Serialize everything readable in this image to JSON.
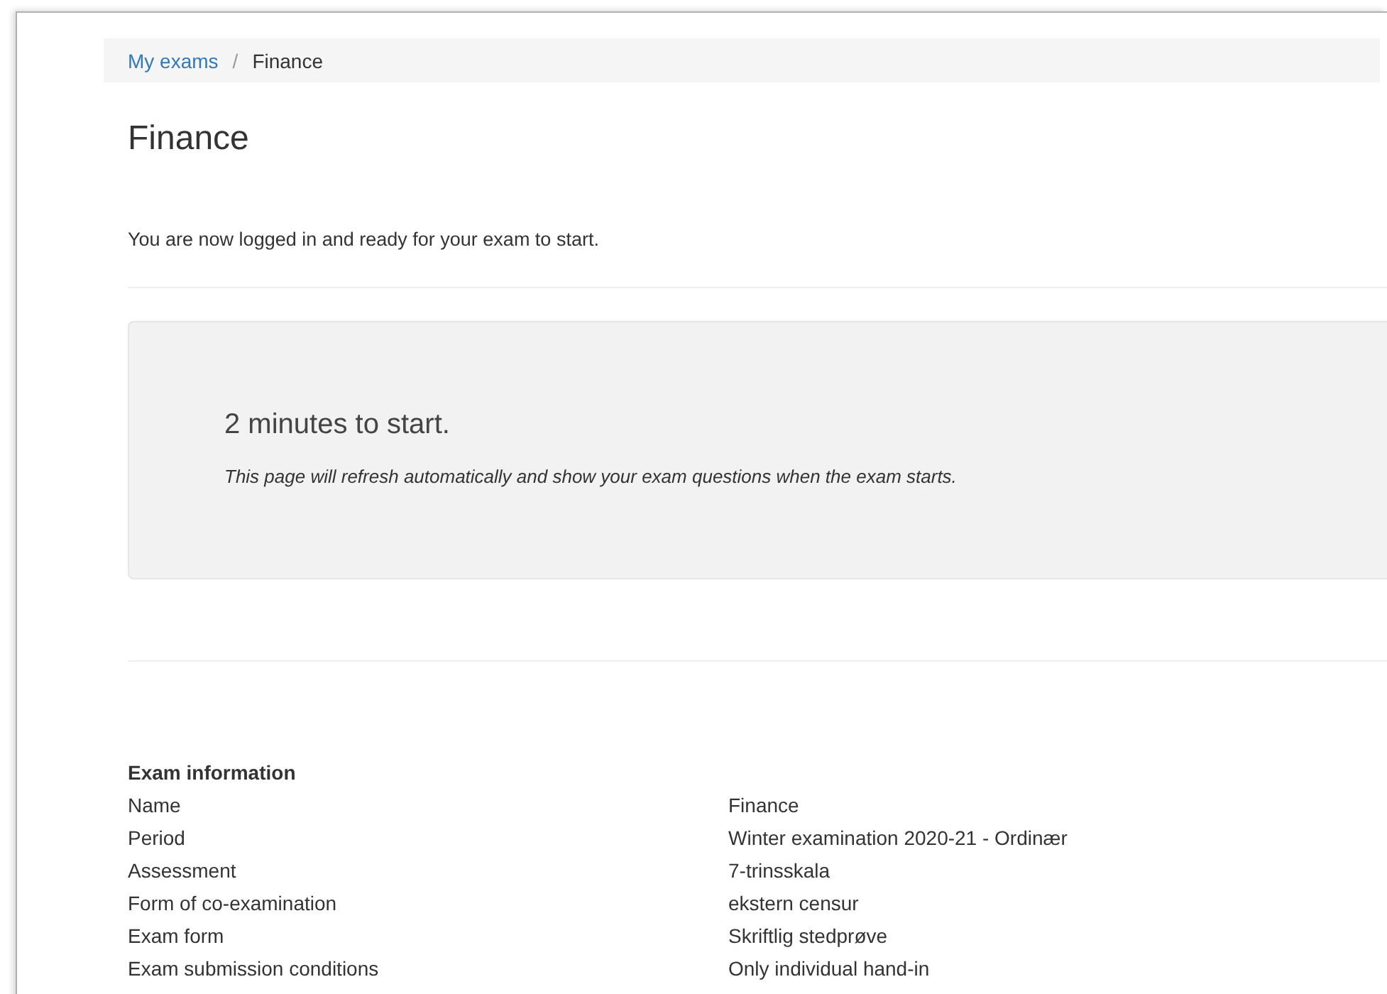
{
  "breadcrumb": [
    {
      "label": "My exams",
      "kind": "link"
    },
    {
      "label": "Finance",
      "kind": "current"
    }
  ],
  "breadcrumb_separator": "/",
  "title": "Finance",
  "intro": "You are now logged in and ready for your exam to start.",
  "countdown": {
    "heading": "2 minutes to start.",
    "note": "This page will refresh automatically and show your exam questions when the exam starts."
  },
  "exam_information": {
    "heading": "Exam information",
    "rows": [
      {
        "label": "Name",
        "value": "Finance"
      },
      {
        "label": "Period",
        "value": "Winter examination 2020-21 - Ordinær"
      },
      {
        "label": "Assessment",
        "value": "7-trinsskala"
      },
      {
        "label": "Form of co-examination",
        "value": "ekstern censur"
      },
      {
        "label": "Exam form",
        "value": "Skriftlig stedprøve"
      },
      {
        "label": "Exam submission conditions",
        "value": "Only individual hand-in"
      }
    ]
  }
}
